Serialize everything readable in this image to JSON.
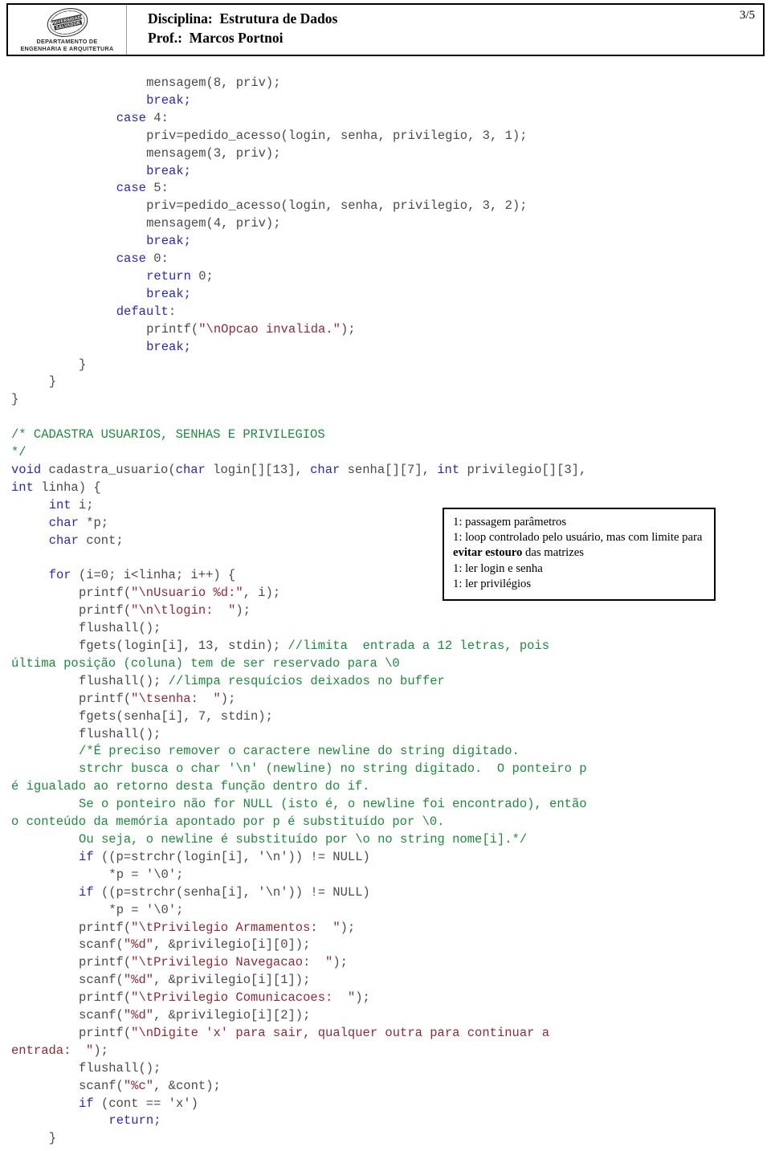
{
  "header": {
    "logo": {
      "seal_text_top": "UNIVERSIDADE",
      "seal_text_bottom": "SALVADOR",
      "dept_line1": "DEPARTAMENTO DE",
      "dept_line2": "ENGENHARIA E ARQUITETURA"
    },
    "title_line1": "Disciplina:  Estrutura de Dados",
    "title_line2": "Prof.:  Marcos Portnoi",
    "page_number": "3/5"
  },
  "colors": {
    "keyword": "#2a2ab4",
    "string": "#8c2b36",
    "comment": "#1f8a3c",
    "plain": "#4a4a4a",
    "border": "#000000"
  },
  "code": {
    "language": "C",
    "lines": [
      {
        "indent": 18,
        "segments": [
          {
            "t": "mensagem(8, priv);",
            "c": "pln"
          }
        ]
      },
      {
        "indent": 18,
        "segments": [
          {
            "t": "break;",
            "c": "kw"
          }
        ]
      },
      {
        "indent": 14,
        "segments": [
          {
            "t": "case",
            "c": "kw"
          },
          {
            "t": " 4:",
            "c": "pln"
          }
        ]
      },
      {
        "indent": 18,
        "segments": [
          {
            "t": "priv=pedido_acesso(login, senha, privilegio, 3, 1);",
            "c": "pln"
          }
        ]
      },
      {
        "indent": 18,
        "segments": [
          {
            "t": "mensagem(3, priv);",
            "c": "pln"
          }
        ]
      },
      {
        "indent": 18,
        "segments": [
          {
            "t": "break;",
            "c": "kw"
          }
        ]
      },
      {
        "indent": 14,
        "segments": [
          {
            "t": "case",
            "c": "kw"
          },
          {
            "t": " 5:",
            "c": "pln"
          }
        ]
      },
      {
        "indent": 18,
        "segments": [
          {
            "t": "priv=pedido_acesso(login, senha, privilegio, 3, 2);",
            "c": "pln"
          }
        ]
      },
      {
        "indent": 18,
        "segments": [
          {
            "t": "mensagem(4, priv);",
            "c": "pln"
          }
        ]
      },
      {
        "indent": 18,
        "segments": [
          {
            "t": "break;",
            "c": "kw"
          }
        ]
      },
      {
        "indent": 14,
        "segments": [
          {
            "t": "case",
            "c": "kw"
          },
          {
            "t": " 0:",
            "c": "pln"
          }
        ]
      },
      {
        "indent": 18,
        "segments": [
          {
            "t": "return",
            "c": "kw"
          },
          {
            "t": " 0;",
            "c": "pln"
          }
        ]
      },
      {
        "indent": 18,
        "segments": [
          {
            "t": "break;",
            "c": "kw"
          }
        ]
      },
      {
        "indent": 14,
        "segments": [
          {
            "t": "default",
            "c": "kw"
          },
          {
            "t": ":",
            "c": "pln"
          }
        ]
      },
      {
        "indent": 18,
        "segments": [
          {
            "t": "printf(",
            "c": "pln"
          },
          {
            "t": "\"\\nOpcao invalida.\"",
            "c": "str"
          },
          {
            "t": ");",
            "c": "pln"
          }
        ]
      },
      {
        "indent": 18,
        "segments": [
          {
            "t": "break;",
            "c": "kw"
          }
        ]
      },
      {
        "indent": 9,
        "segments": [
          {
            "t": "}",
            "c": "pln"
          }
        ]
      },
      {
        "indent": 5,
        "segments": [
          {
            "t": "}",
            "c": "pln"
          }
        ]
      },
      {
        "indent": 0,
        "segments": [
          {
            "t": "}",
            "c": "pln"
          }
        ]
      },
      {
        "indent": 0,
        "segments": [
          {
            "t": "",
            "c": "pln"
          }
        ]
      },
      {
        "indent": 0,
        "segments": [
          {
            "t": "/* CADASTRA USUARIOS, SENHAS E PRIVILEGIOS",
            "c": "cmt"
          }
        ]
      },
      {
        "indent": 0,
        "segments": [
          {
            "t": "*/",
            "c": "cmt"
          }
        ]
      },
      {
        "indent": 0,
        "segments": [
          {
            "t": "void",
            "c": "kw"
          },
          {
            "t": " cadastra_usuario(",
            "c": "pln"
          },
          {
            "t": "char",
            "c": "kw"
          },
          {
            "t": " login[][13], ",
            "c": "pln"
          },
          {
            "t": "char",
            "c": "kw"
          },
          {
            "t": " senha[][7], ",
            "c": "pln"
          },
          {
            "t": "int",
            "c": "kw"
          },
          {
            "t": " privilegio[][3],",
            "c": "pln"
          }
        ]
      },
      {
        "indent": 0,
        "segments": [
          {
            "t": "int",
            "c": "kw"
          },
          {
            "t": " linha) {",
            "c": "pln"
          }
        ]
      },
      {
        "indent": 5,
        "segments": [
          {
            "t": "int",
            "c": "kw"
          },
          {
            "t": " i;",
            "c": "pln"
          }
        ]
      },
      {
        "indent": 5,
        "segments": [
          {
            "t": "char",
            "c": "kw"
          },
          {
            "t": " *p;",
            "c": "pln"
          }
        ]
      },
      {
        "indent": 5,
        "segments": [
          {
            "t": "char",
            "c": "kw"
          },
          {
            "t": " cont;",
            "c": "pln"
          }
        ]
      },
      {
        "indent": 0,
        "segments": [
          {
            "t": "",
            "c": "pln"
          }
        ]
      },
      {
        "indent": 5,
        "segments": [
          {
            "t": "for",
            "c": "kw"
          },
          {
            "t": " (i=0; i<linha; i++) {",
            "c": "pln"
          }
        ]
      },
      {
        "indent": 9,
        "segments": [
          {
            "t": "printf(",
            "c": "pln"
          },
          {
            "t": "\"\\nUsuario %d:\"",
            "c": "str"
          },
          {
            "t": ", i);",
            "c": "pln"
          }
        ]
      },
      {
        "indent": 9,
        "segments": [
          {
            "t": "printf(",
            "c": "pln"
          },
          {
            "t": "\"\\n\\tlogin:  \"",
            "c": "str"
          },
          {
            "t": ");",
            "c": "pln"
          }
        ]
      },
      {
        "indent": 9,
        "segments": [
          {
            "t": "flushall();",
            "c": "pln"
          }
        ]
      },
      {
        "indent": 9,
        "segments": [
          {
            "t": "fgets(login[i], 13, stdin); ",
            "c": "pln"
          },
          {
            "t": "//limita  entrada a 12 letras, pois",
            "c": "cmt"
          }
        ]
      },
      {
        "indent": 0,
        "segments": [
          {
            "t": "última posição (coluna) tem de ser reservado para \\0",
            "c": "cmt"
          }
        ]
      },
      {
        "indent": 9,
        "segments": [
          {
            "t": "flushall(); ",
            "c": "pln"
          },
          {
            "t": "//limpa resquícios deixados no buffer",
            "c": "cmt"
          }
        ]
      },
      {
        "indent": 9,
        "segments": [
          {
            "t": "printf(",
            "c": "pln"
          },
          {
            "t": "\"\\tsenha:  \"",
            "c": "str"
          },
          {
            "t": ");",
            "c": "pln"
          }
        ]
      },
      {
        "indent": 9,
        "segments": [
          {
            "t": "fgets(senha[i], 7, stdin);",
            "c": "pln"
          }
        ]
      },
      {
        "indent": 9,
        "segments": [
          {
            "t": "flushall();",
            "c": "pln"
          }
        ]
      },
      {
        "indent": 9,
        "segments": [
          {
            "t": "/*É preciso remover o caractere newline do string digitado.",
            "c": "cmt"
          }
        ]
      },
      {
        "indent": 9,
        "segments": [
          {
            "t": "strchr busca o char '\\n' (newline) no string digitado.  O ponteiro p",
            "c": "cmt"
          }
        ]
      },
      {
        "indent": 0,
        "segments": [
          {
            "t": "é igualado ao retorno desta função dentro do if.",
            "c": "cmt"
          }
        ]
      },
      {
        "indent": 9,
        "segments": [
          {
            "t": "Se o ponteiro não for NULL (isto é, o newline foi encontrado), então",
            "c": "cmt"
          }
        ]
      },
      {
        "indent": 0,
        "segments": [
          {
            "t": "o conteúdo da memória apontado por p é substituído por \\0.",
            "c": "cmt"
          }
        ]
      },
      {
        "indent": 9,
        "segments": [
          {
            "t": "Ou seja, o newline é substituído por \\o no string nome[i].*/",
            "c": "cmt"
          }
        ]
      },
      {
        "indent": 9,
        "segments": [
          {
            "t": "if",
            "c": "kw"
          },
          {
            "t": " ((p=strchr(login[i], '\\n')) != NULL)",
            "c": "pln"
          }
        ]
      },
      {
        "indent": 13,
        "segments": [
          {
            "t": "*p = '\\0';",
            "c": "pln"
          }
        ]
      },
      {
        "indent": 9,
        "segments": [
          {
            "t": "if",
            "c": "kw"
          },
          {
            "t": " ((p=strchr(senha[i], '\\n')) != NULL)",
            "c": "pln"
          }
        ]
      },
      {
        "indent": 13,
        "segments": [
          {
            "t": "*p = '\\0';",
            "c": "pln"
          }
        ]
      },
      {
        "indent": 9,
        "segments": [
          {
            "t": "printf(",
            "c": "pln"
          },
          {
            "t": "\"\\tPrivilegio Armamentos:  \"",
            "c": "str"
          },
          {
            "t": ");",
            "c": "pln"
          }
        ]
      },
      {
        "indent": 9,
        "segments": [
          {
            "t": "scanf(",
            "c": "pln"
          },
          {
            "t": "\"%d\"",
            "c": "str"
          },
          {
            "t": ", &privilegio[i][0]);",
            "c": "pln"
          }
        ]
      },
      {
        "indent": 9,
        "segments": [
          {
            "t": "printf(",
            "c": "pln"
          },
          {
            "t": "\"\\tPrivilegio Navegacao:  \"",
            "c": "str"
          },
          {
            "t": ");",
            "c": "pln"
          }
        ]
      },
      {
        "indent": 9,
        "segments": [
          {
            "t": "scanf(",
            "c": "pln"
          },
          {
            "t": "\"%d\"",
            "c": "str"
          },
          {
            "t": ", &privilegio[i][1]);",
            "c": "pln"
          }
        ]
      },
      {
        "indent": 9,
        "segments": [
          {
            "t": "printf(",
            "c": "pln"
          },
          {
            "t": "\"\\tPrivilegio Comunicacoes:  \"",
            "c": "str"
          },
          {
            "t": ");",
            "c": "pln"
          }
        ]
      },
      {
        "indent": 9,
        "segments": [
          {
            "t": "scanf(",
            "c": "pln"
          },
          {
            "t": "\"%d\"",
            "c": "str"
          },
          {
            "t": ", &privilegio[i][2]);",
            "c": "pln"
          }
        ]
      },
      {
        "indent": 9,
        "segments": [
          {
            "t": "printf(",
            "c": "pln"
          },
          {
            "t": "\"\\nDigite 'x' para sair, qualquer outra para continuar a",
            "c": "str"
          }
        ]
      },
      {
        "indent": 0,
        "segments": [
          {
            "t": "entrada:  \"",
            "c": "str"
          },
          {
            "t": ");",
            "c": "pln"
          }
        ]
      },
      {
        "indent": 9,
        "segments": [
          {
            "t": "flushall();",
            "c": "pln"
          }
        ]
      },
      {
        "indent": 9,
        "segments": [
          {
            "t": "scanf(",
            "c": "pln"
          },
          {
            "t": "\"%c\"",
            "c": "str"
          },
          {
            "t": ", &cont);",
            "c": "pln"
          }
        ]
      },
      {
        "indent": 9,
        "segments": [
          {
            "t": "if",
            "c": "kw"
          },
          {
            "t": " (cont == 'x')",
            "c": "pln"
          }
        ]
      },
      {
        "indent": 13,
        "segments": [
          {
            "t": "return",
            "c": "kw"
          },
          {
            "t": ";",
            "c": "pln"
          }
        ]
      },
      {
        "indent": 5,
        "segments": [
          {
            "t": "}",
            "c": "pln"
          }
        ]
      }
    ]
  },
  "annotation": {
    "lines": [
      {
        "text": "1:  passagem parâmetros"
      },
      {
        "text": "1:  loop controlado pelo usuário, mas com limite para ",
        "bold": "evitar estouro",
        "after": " das matrizes"
      },
      {
        "text": "1:  ler login e senha"
      },
      {
        "text": "1:  ler privilégios"
      }
    ]
  }
}
